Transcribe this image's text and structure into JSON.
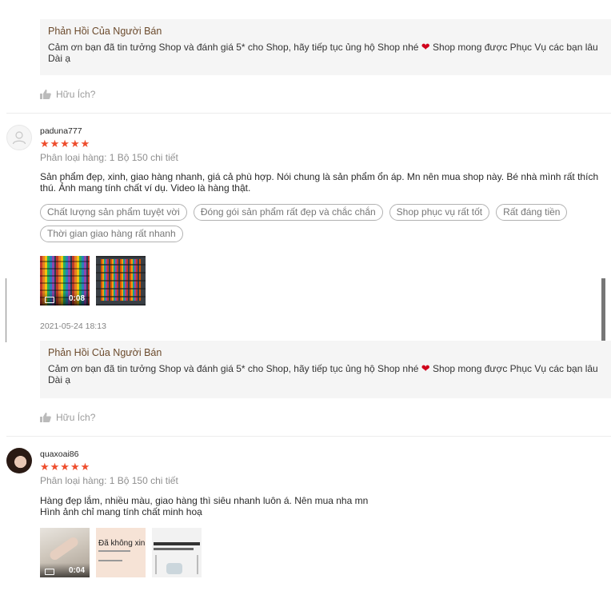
{
  "reply_1": {
    "title": "Phản Hồi Của Người Bán",
    "text_before_heart": "Cảm ơn bạn đã tin tưởng Shop và đánh giá 5* cho Shop, hãy tiếp tục ủng hộ Shop nhé",
    "heart": "❤",
    "text_after_heart": "Shop mong được Phục Vụ các bạn lâu Dài ạ"
  },
  "helpful_1": "Hữu Ích?",
  "review_1": {
    "username": "paduna777",
    "stars": "★★★★★",
    "variant": "Phân loại hàng: 1 Bộ 150 chi tiết",
    "text": "Sản phẩm đẹp, xinh, giao hàng nhanh, giá cả phù hợp. Nói chung là sản phẩm ổn áp. Mn nên mua shop này. Bé nhà mình rất thích thú. Ảnh mang tính chất ví dụ. Video là hàng thật.",
    "tags": [
      "Chất lượng sản phẩm tuyệt vời",
      "Đóng gói sản phẩm rất đẹp và chắc chắn",
      "Shop phục vụ rất tốt",
      "Rất đáng tiền",
      "Thời gian giao hàng rất nhanh"
    ],
    "video_duration": "0:08",
    "date": "2021-05-24 18:13"
  },
  "reply_2": {
    "title": "Phản Hồi Của Người Bán",
    "text_before_heart": "Cảm ơn bạn đã tin tưởng Shop và đánh giá 5* cho Shop, hãy tiếp tục ủng hộ Shop nhé",
    "heart": "❤",
    "text_after_heart": "Shop mong được Phục Vụ các bạn lâu Dài ạ"
  },
  "helpful_2": "Hữu Ích?",
  "review_2": {
    "username": "quaxoai86",
    "stars": "★★★★★",
    "variant": "Phân loại hàng: 1 Bộ 150 chi tiết",
    "text_line1": "Hàng đẹp lắm, nhiều màu, giao hàng thì siêu nhanh luôn á. Nên mua nha mn",
    "text_line2": "Hình ảnh chỉ mang tính chất minh hoạ",
    "video_duration": "0:04",
    "image_2_caption": "Đã không xinh"
  },
  "colors": {
    "accent": "#ee4d2d",
    "seller_title": "#6b4a2c",
    "reply_bg": "#f5f5f5"
  }
}
